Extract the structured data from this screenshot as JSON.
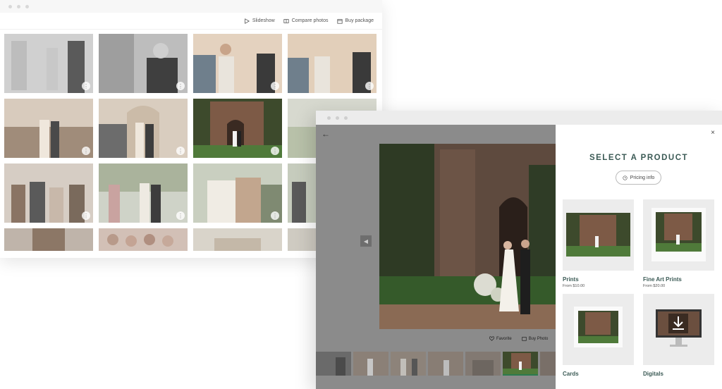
{
  "gallery": {
    "toolbar": {
      "slideshow": "Slideshow",
      "compare": "Compare photos",
      "buy_package": "Buy package"
    },
    "more_symbol": "⋮"
  },
  "viewer": {
    "back_symbol": "←",
    "prev_symbol": "◀",
    "favorite": "Favorite",
    "buy_photo": "Buy Photo"
  },
  "panel": {
    "close_symbol": "×",
    "title": "SELECT A PRODUCT",
    "pricing_info": "Pricing info",
    "products": [
      {
        "name": "Prints",
        "price": "From $10.00"
      },
      {
        "name": "Fine Art Prints",
        "price": "From $20.00"
      },
      {
        "name": "Cards",
        "price": ""
      },
      {
        "name": "Digitals",
        "price": ""
      }
    ]
  },
  "colors": {
    "accent": "#3b5a55",
    "active_thumb": "#2d7a4f"
  }
}
